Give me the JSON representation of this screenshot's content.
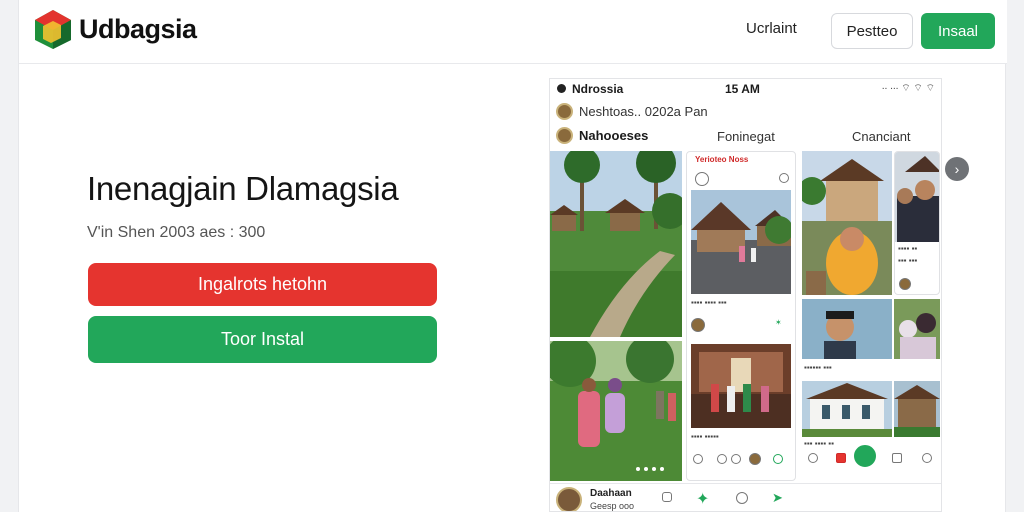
{
  "header": {
    "brand": "Udbagsia",
    "nav_link": "Ucrlaint",
    "outline_button": "Pestteo",
    "primary_button": "Insaal"
  },
  "hero": {
    "title": "Inenagjain Dlamagsia",
    "subtitle": "V'in Shen 2003 aes  : 300",
    "red_button": "Ingalrots hetohn",
    "green_button": "Toor Instal"
  },
  "phone": {
    "status": {
      "app": "Ndrossia",
      "time": "15 AM",
      "icons": "∙∙ ∙∙∙ ⌔ ⌔ ⌔"
    },
    "account_line": "Neshtoas.. 0202a Pan",
    "tabs": [
      "Nahooeses",
      "Foninegat",
      "Cnanciant"
    ],
    "card_header_red": "Yerioteo Noss",
    "bottom_label_1": "Daahaan",
    "bottom_label_2": "Geesp ooo"
  },
  "colors": {
    "green": "#22a75a",
    "red": "#e5342f"
  }
}
